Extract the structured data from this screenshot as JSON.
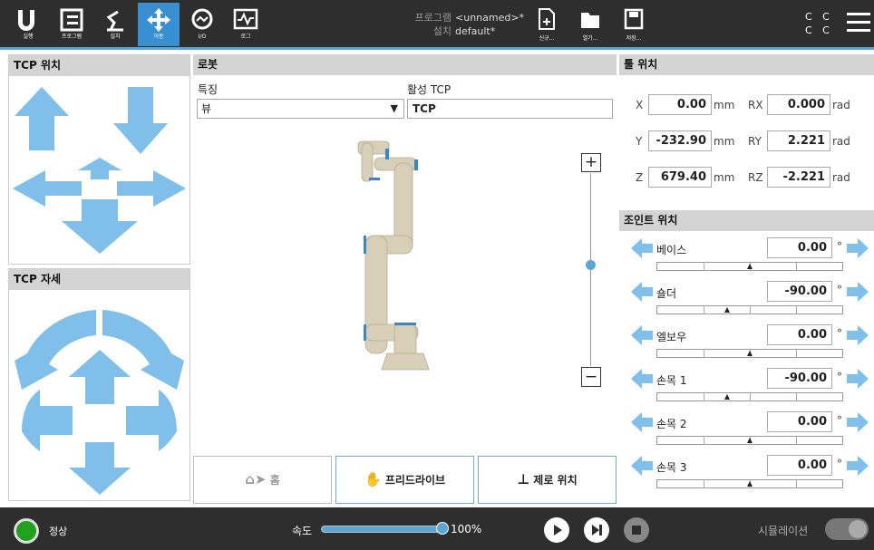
{
  "nav": [
    {
      "label": "실행",
      "icon": "ur-logo-icon"
    },
    {
      "label": "프로그램",
      "icon": "program-icon"
    },
    {
      "label": "설치",
      "icon": "installation-icon"
    },
    {
      "label": "이동",
      "icon": "move-icon"
    },
    {
      "label": "I/O",
      "icon": "io-icon"
    },
    {
      "label": "로그",
      "icon": "log-icon"
    }
  ],
  "program": {
    "program_key": "프로그램",
    "program_val": "<unnamed>*",
    "install_key": "설치",
    "install_val": "default*"
  },
  "file": [
    {
      "label": "신규..."
    },
    {
      "label": "열기..."
    },
    {
      "label": "저장..."
    }
  ],
  "cc": {
    "line1": "C C",
    "line2": "C C"
  },
  "tcp_pos": {
    "title": "TCP 위치"
  },
  "tcp_orient": {
    "title": "TCP 자세"
  },
  "robot": {
    "title": "로봇",
    "feature_label": "특징",
    "feature_value": "뷰",
    "active_tcp_label": "활성 TCP",
    "active_tcp_value": "TCP",
    "zoom_in": "+",
    "zoom_out": "−"
  },
  "tool_pos": {
    "title": "툴 위치",
    "rows": [
      {
        "axis": "X",
        "value": "0.00",
        "unit": "mm",
        "raxis": "RX",
        "rvalue": "0.000",
        "runit": "rad"
      },
      {
        "axis": "Y",
        "value": "-232.90",
        "unit": "mm",
        "raxis": "RY",
        "rvalue": "2.221",
        "runit": "rad"
      },
      {
        "axis": "Z",
        "value": "679.40",
        "unit": "mm",
        "raxis": "RZ",
        "rvalue": "-2.221",
        "runit": "rad"
      }
    ]
  },
  "joints": {
    "title": "조인트 위치",
    "unit": "°",
    "items": [
      {
        "name": "베이스",
        "value": "0.00",
        "level": 0.5
      },
      {
        "name": "숄더",
        "value": "-90.00",
        "level": 0.375
      },
      {
        "name": "엘보우",
        "value": "0.00",
        "level": 0.5
      },
      {
        "name": "손목 1",
        "value": "-90.00",
        "level": 0.375
      },
      {
        "name": "손목 2",
        "value": "0.00",
        "level": 0.5
      },
      {
        "name": "손목 3",
        "value": "0.00",
        "level": 0.5
      }
    ]
  },
  "buttons": {
    "home": "홈",
    "freedrive": "프리드라이브",
    "zero": "제로 위치"
  },
  "bottom": {
    "status": "정상",
    "speed_label": "속도",
    "speed_value": "100%",
    "speed_level": 1.0,
    "simulation": "시뮬레이션"
  },
  "colors": {
    "accent": "#5ba6d6",
    "arrow": "#7fbfea",
    "topbar": "#2e2e2e",
    "status": "#22a020"
  }
}
